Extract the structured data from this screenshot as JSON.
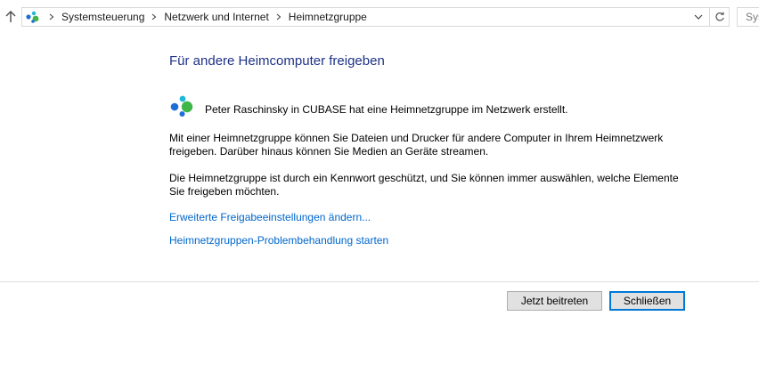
{
  "address_bar": {
    "breadcrumbs": [
      "Systemsteuerung",
      "Netzwerk und Internet",
      "Heimnetzgruppe"
    ],
    "icons": {
      "up": "up-arrow-icon",
      "location": "homegroup-icon",
      "separator": "chevron-right-icon",
      "dropdown": "chevron-down-icon",
      "refresh": "refresh-icon"
    }
  },
  "search": {
    "placeholder": "Sys"
  },
  "content": {
    "title": "Für andere Heimcomputer freigeben",
    "homegroup_message": "Peter Raschinsky in CUBASE hat eine Heimnetzgruppe im Netzwerk erstellt.",
    "paragraph1": "Mit einer Heimnetzgruppe können Sie Dateien und Drucker für andere Computer in Ihrem Heimnetzwerk freigeben. Darüber hinaus können Sie Medien an Geräte streamen.",
    "paragraph2": "Die Heimnetzgruppe ist durch ein Kennwort geschützt, und Sie können immer auswählen, welche Elemente Sie freigeben möchten.",
    "link_advanced": "Erweiterte Freigabeeinstellungen ändern...",
    "link_troubleshoot": "Heimnetzgruppen-Problembehandlung starten"
  },
  "buttons": {
    "join": "Jetzt beitreten",
    "close": "Schließen"
  },
  "colors": {
    "title": "#1e3287",
    "link": "#0066cc",
    "focus_border": "#0078d7",
    "button_bg": "#e1e1e1"
  }
}
